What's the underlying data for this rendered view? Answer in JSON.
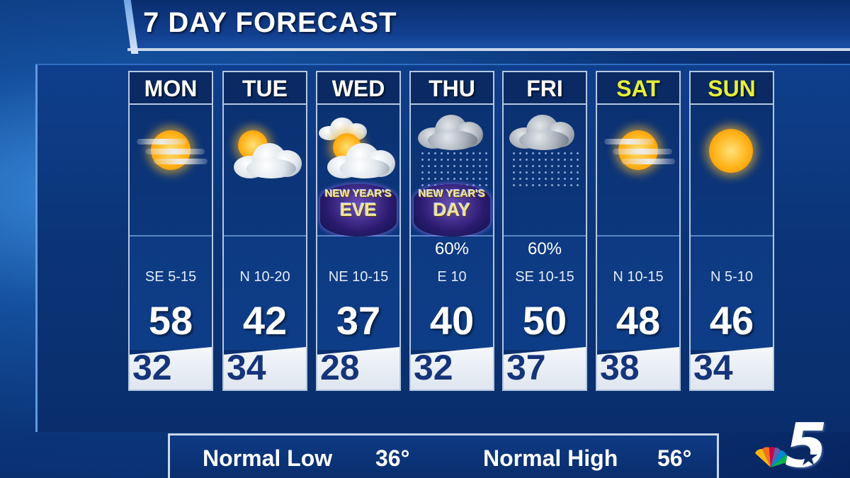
{
  "header": {
    "title": "7 DAY FORECAST"
  },
  "days": [
    {
      "name": "MON",
      "weekend": false,
      "icon": "partly-sunny-haze-icon",
      "precip": "",
      "wind": "SE 5-15",
      "high": "58",
      "low": "32"
    },
    {
      "name": "TUE",
      "weekend": false,
      "icon": "partly-cloudy-icon",
      "precip": "",
      "wind": "N 10-20",
      "high": "42",
      "low": "34"
    },
    {
      "name": "WED",
      "weekend": false,
      "icon": "mostly-cloudy-icon",
      "precip": "",
      "wind": "NE 10-15",
      "high": "37",
      "low": "28",
      "holiday": {
        "line1": "NEW YEAR'S",
        "line2": "EVE"
      }
    },
    {
      "name": "THU",
      "weekend": false,
      "icon": "rain-icon",
      "precip": "60%",
      "wind": "E 10",
      "high": "40",
      "low": "32",
      "holiday": {
        "line1": "NEW YEAR'S",
        "line2": "DAY"
      }
    },
    {
      "name": "FRI",
      "weekend": false,
      "icon": "rain-icon",
      "precip": "60%",
      "wind": "SE 10-15",
      "high": "50",
      "low": "37"
    },
    {
      "name": "SAT",
      "weekend": true,
      "icon": "partly-sunny-haze-icon",
      "precip": "",
      "wind": "N 10-15",
      "high": "48",
      "low": "38"
    },
    {
      "name": "SUN",
      "weekend": true,
      "icon": "sunny-icon",
      "precip": "",
      "wind": "N 5-10",
      "high": "46",
      "low": "34"
    }
  ],
  "normals": {
    "low_label": "Normal Low",
    "low_value": "36°",
    "high_label": "Normal High",
    "high_value": "56°"
  },
  "logo": {
    "text": "5",
    "icon": "nbc-peacock-icon"
  },
  "colors": {
    "weekend_day": "#e5f03a",
    "low_temp": "#16347a",
    "background": "#0b3579"
  }
}
